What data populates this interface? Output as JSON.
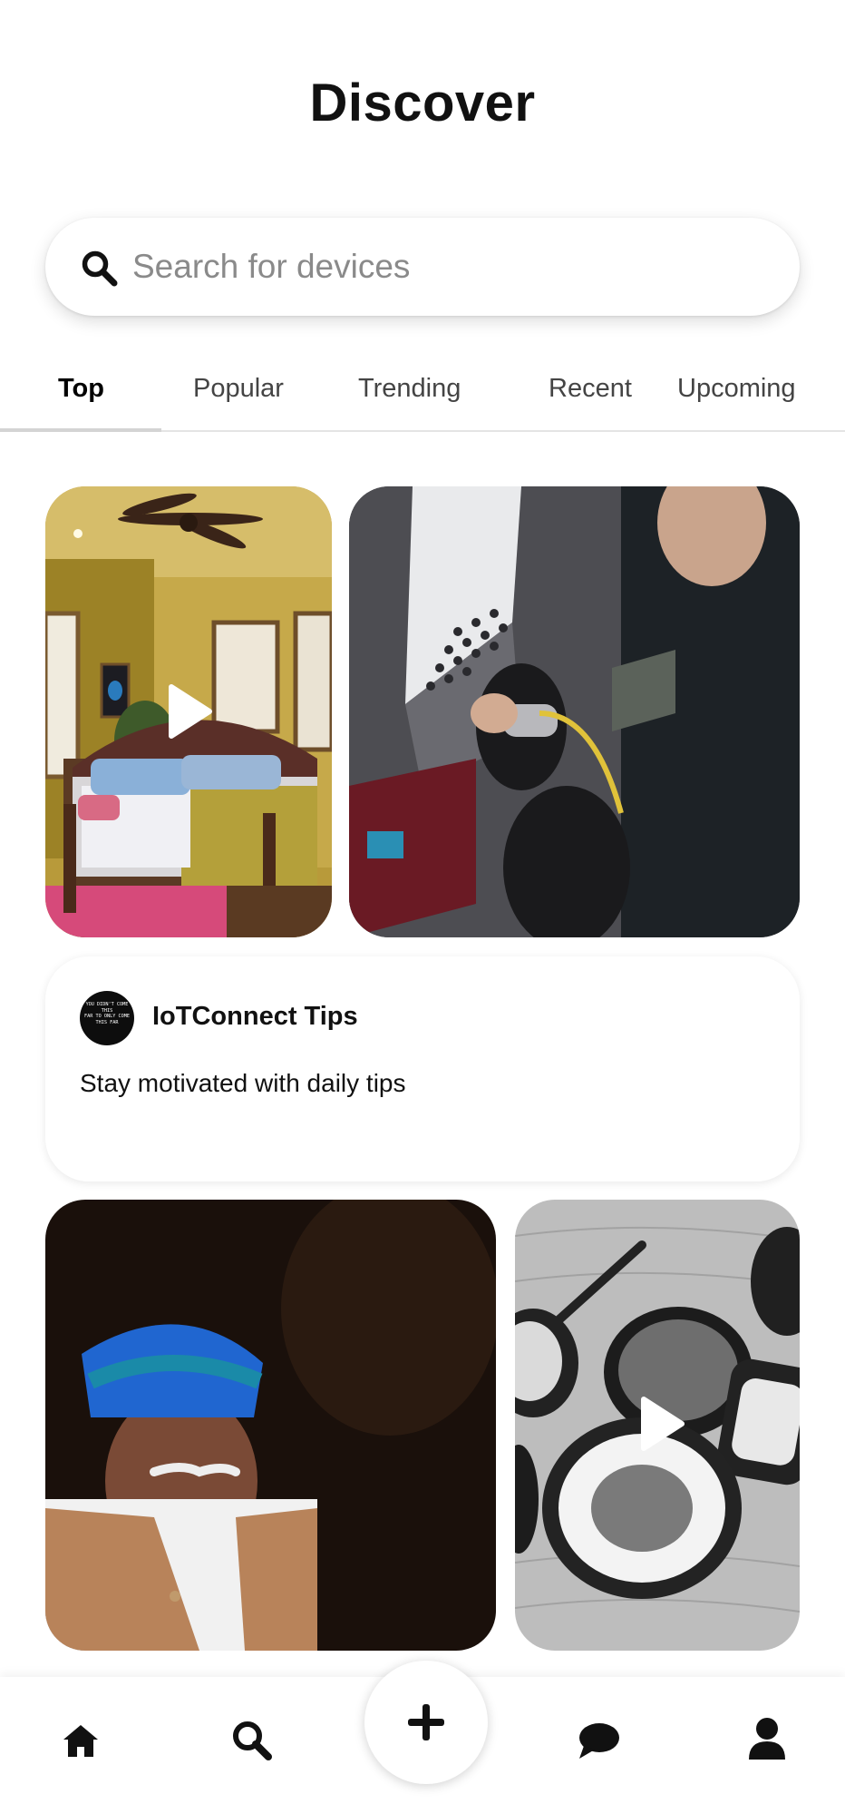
{
  "header": {
    "title": "Discover"
  },
  "search": {
    "placeholder": "Search for devices",
    "value": "",
    "icon": "search-icon"
  },
  "tabs": [
    {
      "label": "Top",
      "active": true
    },
    {
      "label": "Popular",
      "active": false
    },
    {
      "label": "Trending",
      "active": false
    },
    {
      "label": "Recent",
      "active": false
    },
    {
      "label": "Upcoming",
      "active": false
    }
  ],
  "feed": {
    "tiles": [
      {
        "content": "bedroom with ceiling fan",
        "video": true
      },
      {
        "content": "electric car charging",
        "video": false
      },
      {
        "content": "man in blue turban",
        "video": false
      },
      {
        "content": "bowls of ground spices",
        "video": true
      }
    ],
    "tip_card": {
      "avatar_lines": [
        "YOU DIDN'T COME THIS",
        "FAR TO ONLY COME",
        "THIS FAR"
      ],
      "name": "IoTConnect Tips",
      "text": "Stay motivated with daily tips"
    }
  },
  "bottom_nav": {
    "items": [
      "home-icon",
      "search-icon",
      "add-icon",
      "chat-icon",
      "profile-icon"
    ],
    "active": "search-icon"
  },
  "colors": {
    "background": "#ffffff",
    "text": "#111111",
    "muted": "#8a8a8a",
    "active_tab": "#000000"
  }
}
